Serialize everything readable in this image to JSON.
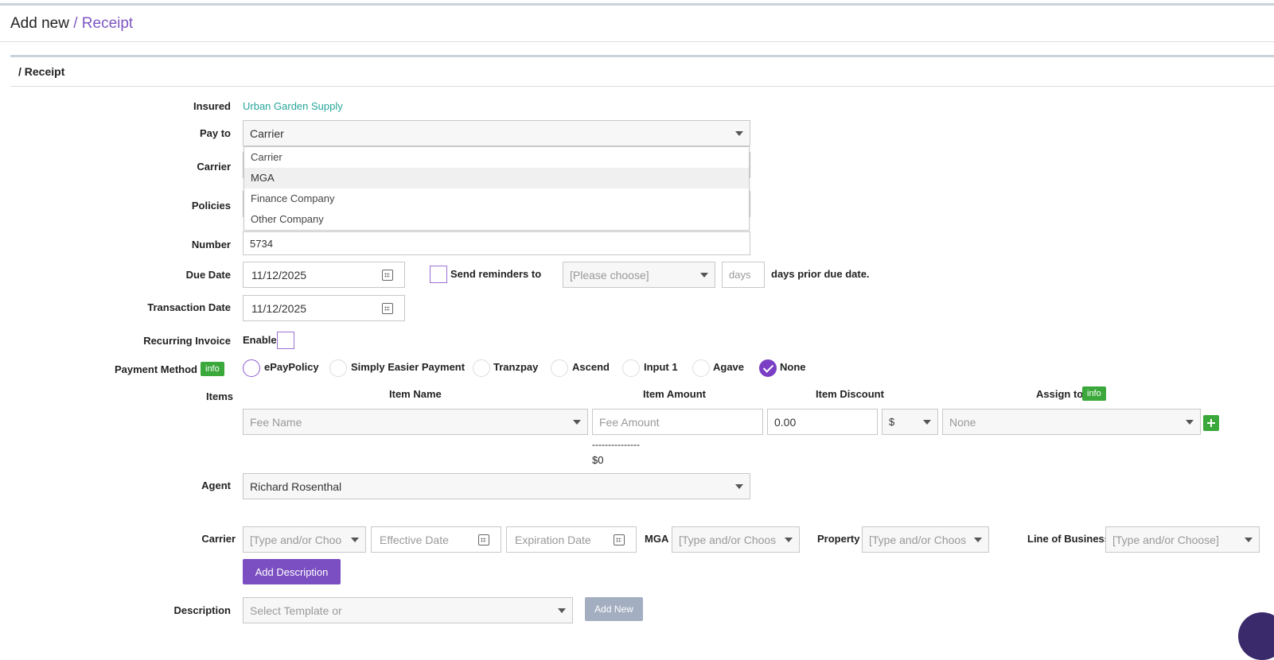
{
  "header": {
    "title": "Add new",
    "crumb": "/ Receipt"
  },
  "panel": {
    "title": "/ Receipt"
  },
  "form": {
    "insured": {
      "label": "Insured",
      "value": "Urban Garden Supply"
    },
    "pay_to": {
      "label": "Pay to",
      "value": "Carrier",
      "options": [
        "Carrier",
        "MGA",
        "Finance Company",
        "Other Company"
      ],
      "highlighted": "MGA"
    },
    "carrier": {
      "label": "Carrier"
    },
    "policies": {
      "label": "Policies"
    },
    "number": {
      "label": "Number",
      "value": "5734"
    },
    "due_date": {
      "label": "Due Date",
      "value": "11/12/2025"
    },
    "reminders": {
      "label": "Send reminders to",
      "select_placeholder": "[Please choose]",
      "days_placeholder": "days",
      "suffix": "days prior due date."
    },
    "transaction_date": {
      "label": "Transaction Date",
      "value": "11/12/2025"
    },
    "recurring": {
      "label": "Recurring Invoice",
      "enable_label": "Enable"
    },
    "payment_method": {
      "label": "Payment Method",
      "info": "info",
      "options": [
        "ePayPolicy",
        "Simply Easier Payment",
        "Tranzpay",
        "Ascend",
        "Input 1",
        "Agave",
        "None"
      ],
      "selected": "None"
    },
    "items": {
      "label": "Items",
      "headers": {
        "name": "Item Name",
        "amount": "Item Amount",
        "discount": "Item Discount",
        "assign": "Assign to"
      },
      "assign_info": "info",
      "row": {
        "name_placeholder": "Fee Name",
        "amount_placeholder": "Fee Amount",
        "discount": "0.00",
        "discount_unit": "$",
        "assign": "None"
      },
      "divider": "---------------",
      "total": "$0"
    },
    "agent": {
      "label": "Agent",
      "value": "Richard Rosenthal"
    },
    "filters": {
      "carrier_label": "Carrier",
      "carrier_placeholder": "[Type and/or Choo",
      "effective_placeholder": "Effective Date",
      "expiration_placeholder": "Expiration Date",
      "mga_label": "MGA",
      "mga_placeholder": "[Type and/or Choos",
      "property_label": "Property",
      "property_placeholder": "[Type and/or Choos",
      "lob_label": "Line of Business",
      "lob_placeholder": "[Type and/or Choose]"
    },
    "add_description": "Add Description",
    "description": {
      "label": "Description",
      "placeholder": "Select Template or",
      "add_new": "Add New"
    }
  },
  "colors": {
    "accent": "#7b4fc2",
    "insured_link": "#26a69a",
    "info_badge": "#3aa83a"
  }
}
